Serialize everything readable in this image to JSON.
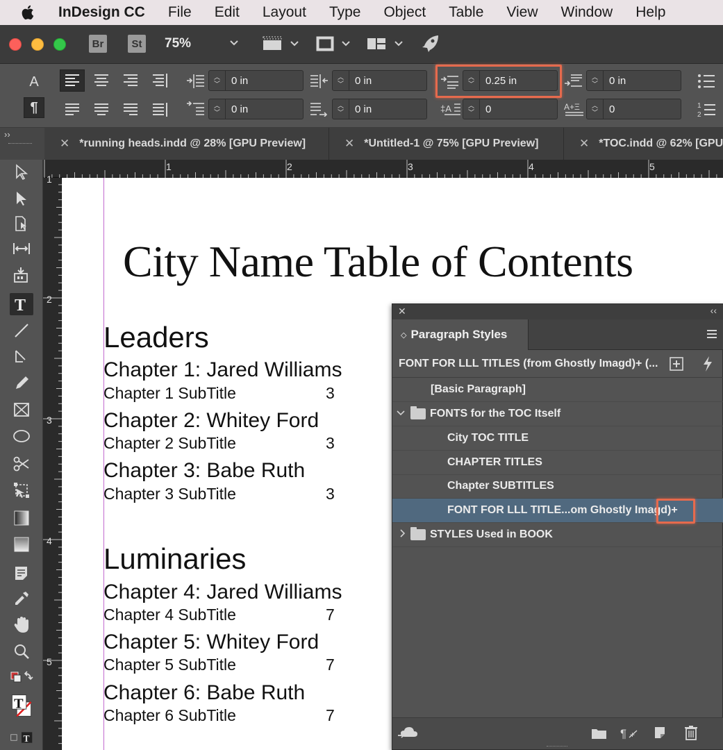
{
  "menubar": {
    "app_name": "InDesign CC",
    "items": [
      "File",
      "Edit",
      "Layout",
      "Type",
      "Object",
      "Table",
      "View",
      "Window",
      "Help"
    ]
  },
  "toolbar": {
    "bridge_label": "Br",
    "stock_label": "St",
    "zoom": "75%"
  },
  "control": {
    "char_mode": "A",
    "para_mode": "¶",
    "left_indent": "0 in",
    "right_indent": "0 in",
    "space_before": "0.25 in",
    "space_after": "0 in",
    "first_line_indent": "0 in",
    "last_line_indent": "0 in",
    "drop_cap_lines": "0",
    "drop_cap_chars": "0"
  },
  "tabs": [
    {
      "label": "*running heads.indd @ 28% [GPU Preview]"
    },
    {
      "label": "*Untitled-1 @ 75% [GPU Preview]"
    },
    {
      "label": "*TOC.indd @ 62% [GPU"
    }
  ],
  "ruler": {
    "h": [
      "1",
      "2",
      "3",
      "4",
      "5"
    ],
    "v": [
      "1",
      "2",
      "3",
      "4",
      "5"
    ]
  },
  "document": {
    "title": "City Name Table of Contents",
    "sections": [
      {
        "heading": "Leaders",
        "chapters": [
          {
            "title": "Chapter 1: Jared Williams",
            "subtitle": "Chapter 1 SubTitle",
            "page": "3"
          },
          {
            "title": "Chapter 2: Whitey Ford",
            "subtitle": "Chapter 2 SubTitle",
            "page": "3"
          },
          {
            "title": "Chapter 3: Babe Ruth",
            "subtitle": "Chapter 3 SubTitle",
            "page": "3"
          }
        ]
      },
      {
        "heading": "Luminaries",
        "chapters": [
          {
            "title": "Chapter 4: Jared Williams",
            "subtitle": "Chapter 4 SubTitle",
            "page": "7"
          },
          {
            "title": "Chapter 5: Whitey Ford",
            "subtitle": "Chapter 5 SubTitle",
            "page": "7"
          },
          {
            "title": "Chapter 6: Babe Ruth",
            "subtitle": "Chapter 6 SubTitle",
            "page": "7"
          }
        ]
      }
    ]
  },
  "paragraph_styles": {
    "panel_title": "Paragraph Styles",
    "current_style": "FONT FOR LLL TITLES (from Ghostly Imagd)+ (...",
    "items": [
      {
        "label": "[Basic Paragraph]"
      },
      {
        "label": "FONTS for the TOC Itself"
      },
      {
        "label": "City TOC TITLE"
      },
      {
        "label": "CHAPTER TITLES"
      },
      {
        "label": "Chapter SUBTITLES"
      },
      {
        "label": "FONT FOR LLL TITLE...om Ghostly Imagd)+"
      },
      {
        "label": "STYLES Used in BOOK"
      }
    ]
  },
  "colors": {
    "highlight": "#e66a4d",
    "selected_row": "#50697f",
    "margin_guide": "#c36bd0"
  }
}
